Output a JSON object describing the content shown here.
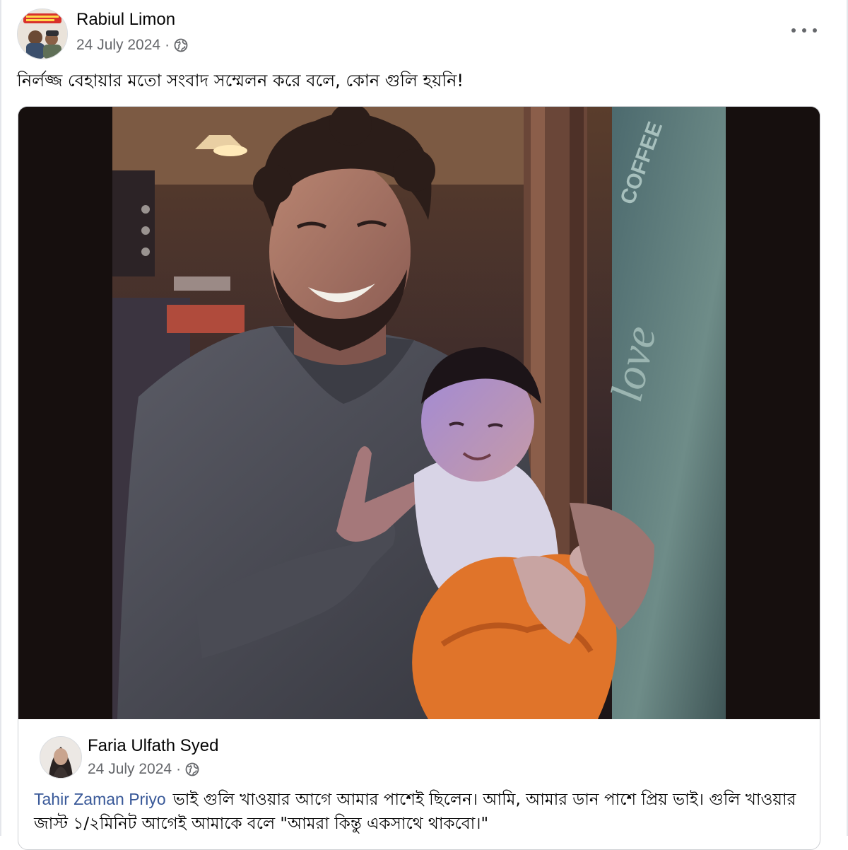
{
  "post": {
    "author": "Rabiul Limon",
    "date": "24 July 2024",
    "separator": "·",
    "privacy_icon": "globe-icon",
    "more_icon": "more-horizontal-icon",
    "text": "নির্লজ্জ বেহায়ার মতো সংবাদ সম্মেলন করে বলে, কোন গুলি হয়নি!"
  },
  "shared": {
    "author": "Faria Ulfath Syed",
    "date": "24 July 2024",
    "separator": "·",
    "privacy_icon": "globe-icon",
    "mention": "Tahir Zaman Priyo",
    "comment": "ভাই গুলি খাওয়ার আগে আমার পাশেই ছিলেন। আমি, আমার ডান পাশে প্রিয় ভাই। গুলি খাওয়ার জাস্ট ১/২মিনিট আগেই আমাকে বলে \"আমরা কিন্তু একসাথে থাকবো।\""
  },
  "photo": {
    "description_icon": "photo-man-holding-baby",
    "window_text": [
      "COFFEE",
      "love"
    ]
  },
  "colors": {
    "link": "#385898",
    "secondary_text": "#65676b",
    "card_border": "#ced0d4"
  }
}
